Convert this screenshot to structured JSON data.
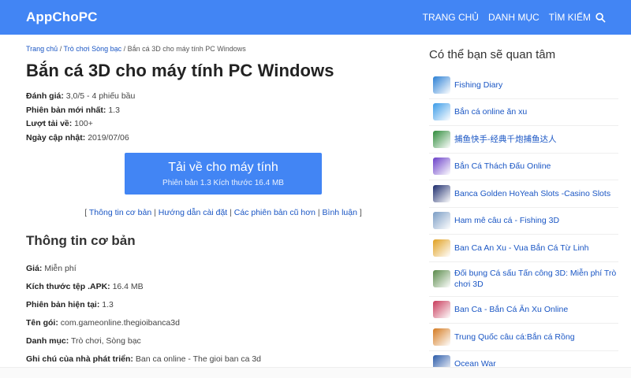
{
  "header": {
    "logo": "AppChoPC",
    "nav": [
      "TRANG CHỦ",
      "DANH MỤC",
      "TÌM KIẾM"
    ]
  },
  "breadcrumb": {
    "home": "Trang chủ",
    "category": "Trò chơi Sòng bạc",
    "current": "Bắn cá 3D cho máy tính PC Windows"
  },
  "page_title": "Bắn cá 3D cho máy tính PC Windows",
  "meta": {
    "rating_label": "Đánh giá:",
    "rating_value": "3,0/5 - 4 phiếu bầu",
    "version_label": "Phiên bản mới nhất:",
    "version_value": "1.3",
    "downloads_label": "Lượt tải về:",
    "downloads_value": "100+",
    "updated_label": "Ngày cập nhật:",
    "updated_value": "2019/07/06"
  },
  "download": {
    "main": "Tải về cho máy tính",
    "sub": "Phiên bản 1.3    Kích thước 16.4 MB"
  },
  "quicklinks": [
    "Thông tin cơ bản",
    "Hướng dẫn cài đặt",
    "Các phiên bản cũ hơn",
    "Bình luận"
  ],
  "section_title": "Thông tin cơ bản",
  "info": {
    "price_label": "Giá:",
    "price_value": "Miễn phí",
    "size_label": "Kích thước tệp .APK:",
    "size_value": "16.4 MB",
    "curver_label": "Phiên bản hiện tại:",
    "curver_value": "1.3",
    "pkg_label": "Tên gói:",
    "pkg_value": "com.gameonline.thegioibanca3d",
    "cat_label": "Danh mục:",
    "cat_value": "Trò chơi, Sòng bạc",
    "dev_label": "Ghi chú của nhà phát triển:",
    "dev_value": "Ban ca online - The gioi ban ca 3d"
  },
  "sidebar": {
    "title": "Có thể bạn sẽ quan tâm",
    "items": [
      {
        "label": "Fishing Diary",
        "color": "#2a7fd4"
      },
      {
        "label": "Bắn cá online ăn xu",
        "color": "#3a9be8"
      },
      {
        "label": "捕鱼快手-经典千炮捕鱼达人",
        "color": "#2e8b3a"
      },
      {
        "label": "Bắn Cá Thách Đấu Online",
        "color": "#6a3fc8"
      },
      {
        "label": "Banca Golden HoYeah Slots -Casino Slots",
        "color": "#1b2a6b"
      },
      {
        "label": "Ham mê câu cá - Fishing 3D",
        "color": "#7a9cc4"
      },
      {
        "label": "Ban Ca An Xu - Vua Bắn Cá Từ Linh",
        "color": "#e0a020"
      },
      {
        "label": "Đối bụng Cá sấu Tấn công 3D: Miễn phí Trò chơi 3D",
        "color": "#5a8a4a"
      },
      {
        "label": "Ban Ca - Bắn Cá Ăn Xu Online",
        "color": "#c83a5a"
      },
      {
        "label": "Trung Quốc câu cá:Bắn cá Rồng",
        "color": "#d47a20"
      },
      {
        "label": "Ocean War",
        "color": "#2a5aa8"
      }
    ]
  }
}
